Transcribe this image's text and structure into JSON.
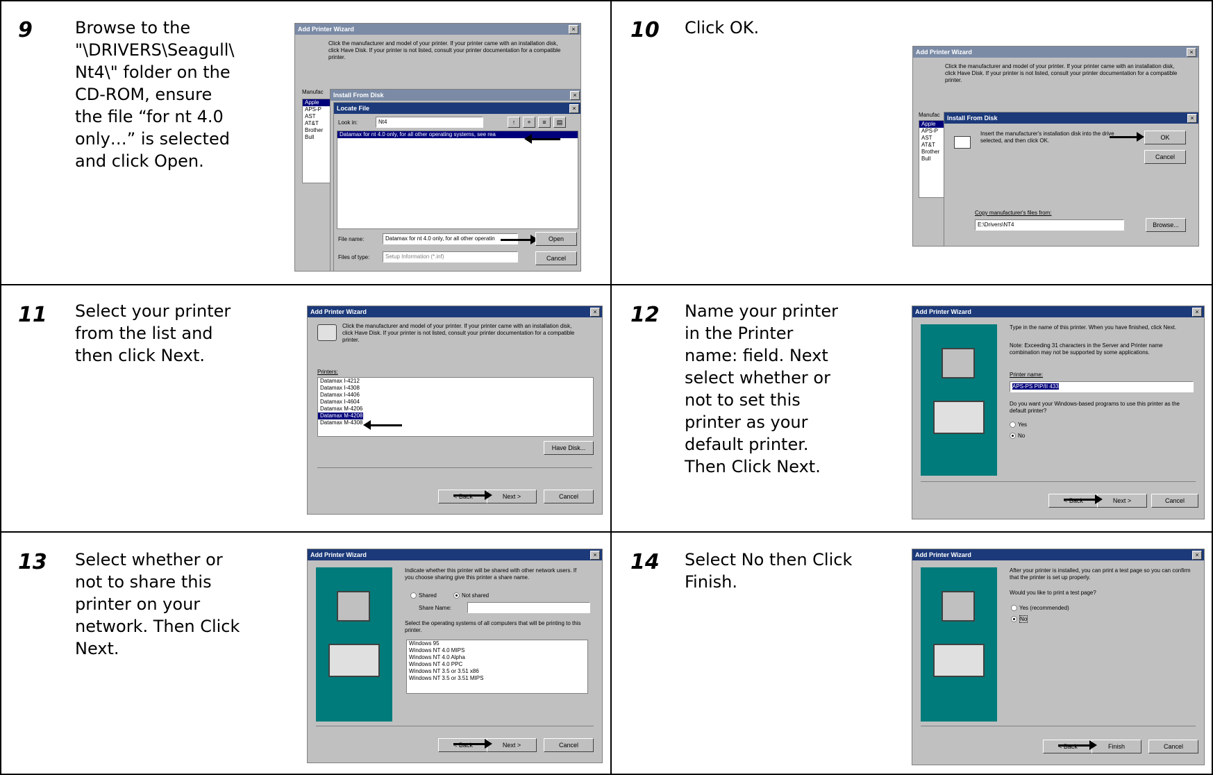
{
  "steps": [
    {
      "number": "9",
      "text": "Browse to the\n\"\\DRIVERS\\Seagull\\\nNt4\\\" folder on the\nCD-ROM, ensure\nthe file “for nt 4.0\nonly…” is selected\nand click Open."
    },
    {
      "number": "10",
      "text": "Click OK."
    },
    {
      "number": "11",
      "text": "Select your printer\nfrom the list and\nthen click Next."
    },
    {
      "number": "12",
      "text": "Name your printer\nin the Printer\nname: field.  Next\nselect whether or\nnot to set this\nprinter as your\ndefault printer.\nThen Click Next."
    },
    {
      "number": "13",
      "text": "Select whether or\nnot to share this\nprinter on your\nnetwork. Then Click\nNext."
    },
    {
      "number": "14",
      "text": "Select No then Click\nFinish."
    }
  ],
  "shot9": {
    "title": "Add Printer Wizard",
    "intro": "Click the manufacturer and model of your printer. If your printer came with an installation disk, click Have Disk. If your printer is not listed, consult your printer documentation for a compatible printer.",
    "install_title": "Install From Disk",
    "locate_title": "Locate File",
    "look_in_label": "Look in:",
    "look_in_value": "Nt4",
    "file_item": "Datamax for nt 4.0 only, for all other operating systems, see rea",
    "file_name_label": "File name:",
    "file_name_value": "Datamax for nt 4.0 only, for all other operatin",
    "files_type_label": "Files of type:",
    "files_type_value": "Setup Information (*.inf)",
    "open_btn": "Open",
    "cancel_btn": "Cancel",
    "manufacturers": [
      "Apple",
      "APS-P",
      "AST",
      "AT&T",
      "Brother",
      "Bull"
    ],
    "manu_label": "Manufac"
  },
  "shot10": {
    "title": "Add Printer Wizard",
    "intro": "Click the manufacturer and model of your printer. If your printer came with an installation disk, click Have Disk. If your printer is not listed, consult your printer documentation for a compatible printer.",
    "install_title": "Install From Disk",
    "insert_text": "Insert the manufacturer's installation disk into the drive selected, and then click OK.",
    "ok_btn": "OK",
    "cancel_btn": "Cancel",
    "copy_label": "Copy manufacturer's files from:",
    "copy_value": "E:\\Drivers\\NT4",
    "browse_btn": "Browse...",
    "manufacturers": [
      "Apple",
      "APS-P",
      "AST",
      "AT&T",
      "Brother",
      "Bull"
    ],
    "manu_label": "Manufac"
  },
  "shot11": {
    "title": "Add Printer Wizard",
    "intro": "Click the manufacturer and model of your printer. If your printer came with an installation disk, click Have Disk. If your printer is not listed, consult your printer documentation for a compatible printer.",
    "printers_label": "Printers:",
    "printers": [
      "Datamax I-4212",
      "Datamax I-4308",
      "Datamax I-4406",
      "Datamax I-4604",
      "Datamax M-4206",
      "Datamax M-4208",
      "Datamax M-4308"
    ],
    "selected_index": 5,
    "have_disk_btn": "Have Disk...",
    "back_btn": "< Back",
    "next_btn": "Next >",
    "cancel_btn": "Cancel"
  },
  "shot12": {
    "title": "Add Printer Wizard",
    "p1": "Type in the name of this printer. When you have finished, click Next.",
    "p2": "Note: Exceeding 31 characters in the Server and Printer name combination may not be supported by some applications.",
    "name_label": "Printer name:",
    "name_value": "APS-PS PIP/II 433",
    "default_q": "Do you want your Windows-based programs to use this printer as the default printer?",
    "yes": "Yes",
    "no": "No",
    "back_btn": "< Back",
    "next_btn": "Next >",
    "cancel_btn": "Cancel"
  },
  "shot13": {
    "title": "Add Printer Wizard",
    "p1": "Indicate whether this printer will be shared with other network users. If you choose sharing give this printer a share name.",
    "shared": "Shared",
    "not_shared": "Not shared",
    "share_name_label": "Share Name:",
    "p2": "Select the operating systems of all computers that will be printing to this printer.",
    "os_list": [
      "Windows 95",
      "Windows NT 4.0 MIPS",
      "Windows NT 4.0 Alpha",
      "Windows NT 4.0 PPC",
      "Windows NT 3.5 or 3.51 x86",
      "Windows NT 3.5 or 3.51 MIPS"
    ],
    "back_btn": "< Back",
    "next_btn": "Next >",
    "cancel_btn": "Cancel"
  },
  "shot14": {
    "title": "Add Printer Wizard",
    "p1": "After your printer is installed, you can print a test page so you can confirm that the printer is set up properly.",
    "q": "Would you like to print a test page?",
    "yes": "Yes (recommended)",
    "no": "No",
    "back_btn": "< Back",
    "finish_btn": "Finish",
    "cancel_btn": "Cancel"
  }
}
